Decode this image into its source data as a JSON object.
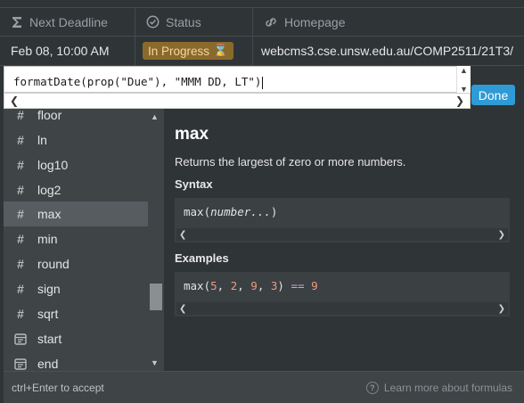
{
  "columns": [
    {
      "label": "Next Deadline",
      "icon": "sigma-icon"
    },
    {
      "label": "Status",
      "icon": "status-icon"
    },
    {
      "label": "Homepage",
      "icon": "link-icon"
    }
  ],
  "row": {
    "deadline": "Feb 08, 10:00 AM",
    "status": "In Progress",
    "status_emoji": "⌛",
    "homepage": "webcms3.cse.unsw.edu.au/COMP2511/21T3/"
  },
  "editor": {
    "formula": "formatDate(prop(\"Due\"), \"MMM DD, LT\")"
  },
  "done_label": "Done",
  "functions": {
    "items": [
      {
        "label": "floor",
        "icon": "hash-icon"
      },
      {
        "label": "ln",
        "icon": "hash-icon"
      },
      {
        "label": "log10",
        "icon": "hash-icon"
      },
      {
        "label": "log2",
        "icon": "hash-icon"
      },
      {
        "label": "max",
        "icon": "hash-icon"
      },
      {
        "label": "min",
        "icon": "hash-icon"
      },
      {
        "label": "round",
        "icon": "hash-icon"
      },
      {
        "label": "sign",
        "icon": "hash-icon"
      },
      {
        "label": "sqrt",
        "icon": "hash-icon"
      },
      {
        "label": "start",
        "icon": "calendar-icon"
      },
      {
        "label": "end",
        "icon": "calendar-icon"
      }
    ],
    "selected": "max"
  },
  "detail": {
    "title": "max",
    "description": "Returns the largest of zero or more numbers.",
    "syntax_heading": "Syntax",
    "syntax_fn": "max(",
    "syntax_arg": "number...",
    "syntax_close": ")",
    "examples_heading": "Examples",
    "example_fn": "max(",
    "example_n1": "5",
    "example_n2": "2",
    "example_n3": "9",
    "example_n4": "3",
    "example_op": "==",
    "example_result": "9"
  },
  "footer": {
    "hint": "ctrl+Enter to accept",
    "learn_more": "Learn more about formulas"
  },
  "colors": {
    "accent": "#2e9bd6",
    "status_badge": "#8a6a2c",
    "panel_bg": "#3f4447"
  }
}
